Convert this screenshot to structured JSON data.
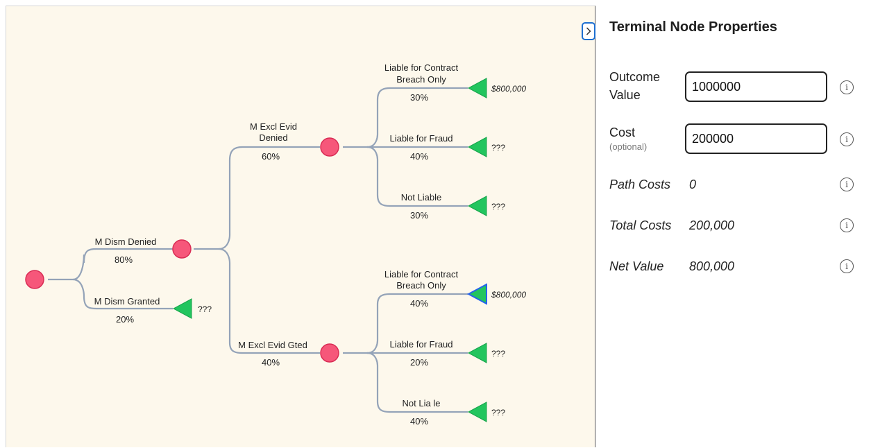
{
  "panel": {
    "title": "Terminal Node Properties",
    "toggle_icon": "chevron-right-icon",
    "outcome": {
      "label_line1": "Outcome",
      "label_line2": "Value",
      "value": "1000000"
    },
    "cost": {
      "label": "Cost",
      "sublabel": "(optional)",
      "value": "200000"
    },
    "path_costs": {
      "label": "Path Costs",
      "value": "0"
    },
    "total_costs": {
      "label": "Total Costs",
      "value": "200,000"
    },
    "net_value": {
      "label": "Net Value",
      "value": "800,000"
    },
    "info_icon": "i"
  },
  "tree": {
    "root": {
      "type": "chance"
    },
    "b1": {
      "line1": "M Dism Denied",
      "line2": "",
      "pct": "80%"
    },
    "b2": {
      "line1": "M Dism Granted",
      "line2": "",
      "pct": "20%",
      "value": "???"
    },
    "b3": {
      "line1": "M Excl Evid",
      "line2": "Denied",
      "pct": "60%"
    },
    "b4": {
      "line1": "M Excl Evid Gted",
      "line2": "",
      "pct": "40%"
    },
    "b5": {
      "line1": "Liable for Contract",
      "line2": "Breach Only",
      "pct": "30%",
      "value": "$800,000"
    },
    "b6": {
      "line1": "Liable for Fraud",
      "line2": "",
      "pct": "40%",
      "value": "???"
    },
    "b7": {
      "line1": "Not Liable",
      "line2": "",
      "pct": "30%",
      "value": "???"
    },
    "b8": {
      "line1": "Liable for Contract",
      "line2": "Breach Only",
      "pct": "40%",
      "value": "$800,000"
    },
    "b9": {
      "line1": "Liable for Fraud",
      "line2": "",
      "pct": "20%",
      "value": "???"
    },
    "b10": {
      "line1": "Not Lia le",
      "line2": "",
      "pct": "40%",
      "value": "???"
    }
  },
  "colors": {
    "canvas_bg": "#fdf8ec",
    "chance_node": "#f6577a",
    "terminal_node": "#22c55e",
    "edge": "#94a3b8",
    "selected_outline": "#2563eb"
  }
}
